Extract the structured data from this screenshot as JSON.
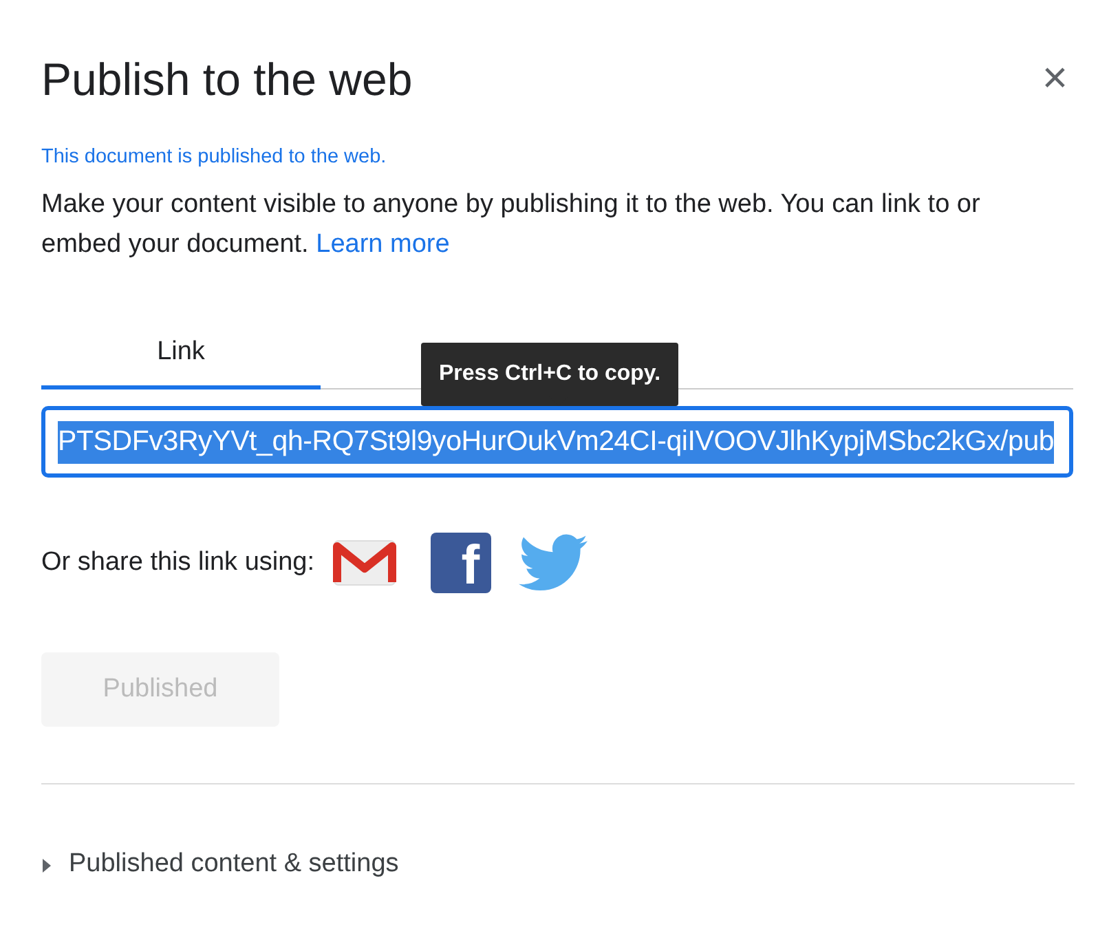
{
  "dialog": {
    "title": "Publish to the web",
    "close": "×"
  },
  "status": "This document is published to the web.",
  "description": "Make your content visible to anyone by publishing it to the web. You can link to or embed your document.",
  "learn_more": "Learn more",
  "tabs": [
    {
      "label": "Link",
      "selected": true
    }
  ],
  "tooltip": "Press Ctrl+C to copy.",
  "link_field": {
    "value": "PTSDFv3RyYVt_qh-RQ7St9l9yoHurOukVm24CI-qiIVOOVJlhKypjMSbc2kGx/pub",
    "selected": true
  },
  "share": {
    "label": "Or share this link using:",
    "services": [
      {
        "kind": "mail"
      },
      {
        "kind": "square",
        "glyph": "f"
      },
      {
        "kind": "bird"
      }
    ]
  },
  "publish_button": {
    "label": "Published",
    "disabled": true
  },
  "settings": {
    "label": "Published content & settings",
    "expanded": false
  }
}
